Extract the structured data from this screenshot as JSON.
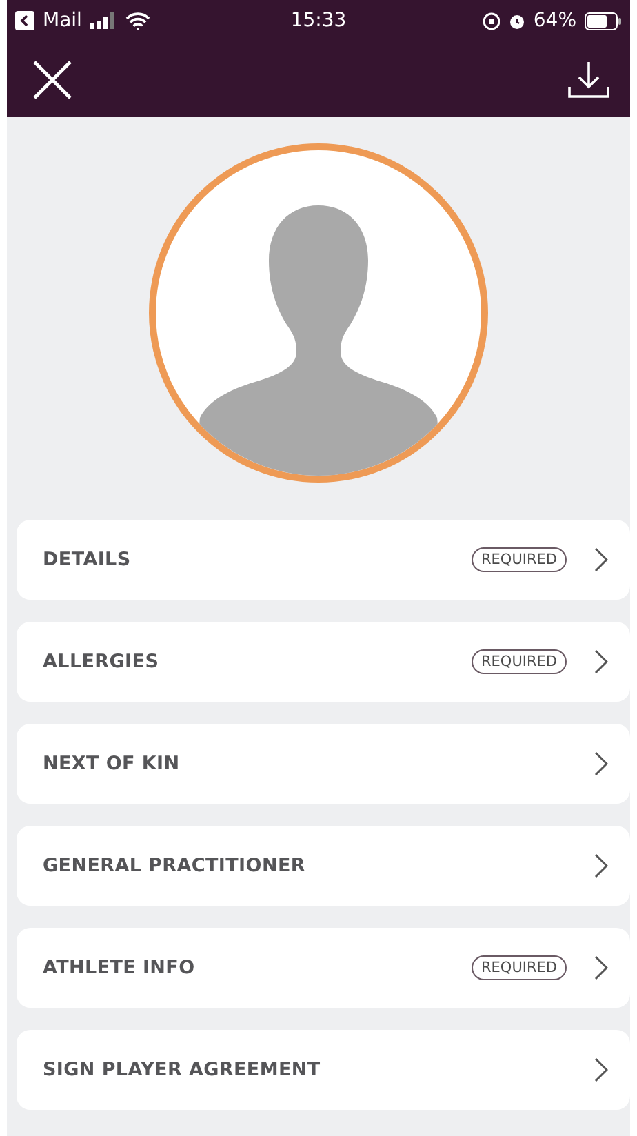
{
  "status_bar": {
    "back_app": "Mail",
    "time": "15:33",
    "battery": "64%"
  },
  "sections": [
    {
      "label": "DETAILS",
      "required": true,
      "badge": "REQUIRED"
    },
    {
      "label": "ALLERGIES",
      "required": true,
      "badge": "REQUIRED"
    },
    {
      "label": "NEXT OF KIN",
      "required": false
    },
    {
      "label": "GENERAL PRACTITIONER",
      "required": false
    },
    {
      "label": "ATHLETE INFO",
      "required": true,
      "badge": "REQUIRED"
    },
    {
      "label": "SIGN PLAYER AGREEMENT",
      "required": false
    }
  ]
}
